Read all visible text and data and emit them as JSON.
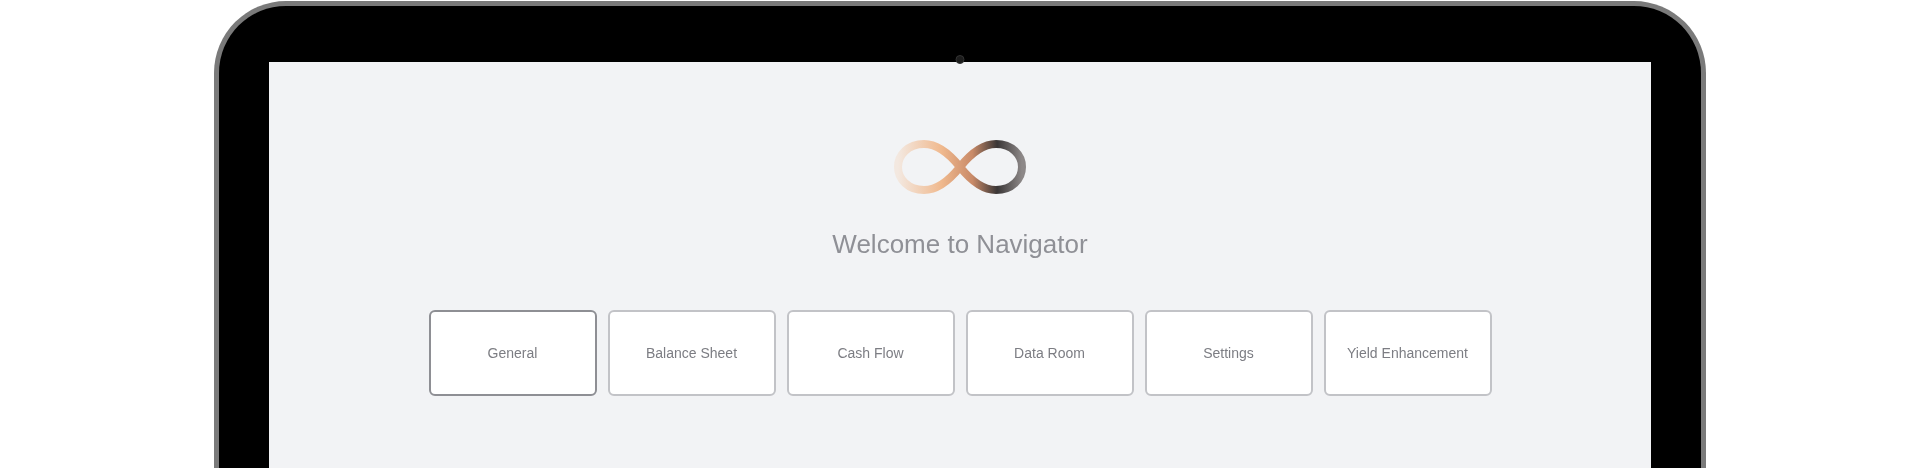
{
  "title": "Welcome to Navigator",
  "buttons": [
    {
      "label": "General",
      "selected": true
    },
    {
      "label": "Balance Sheet",
      "selected": false
    },
    {
      "label": "Cash Flow",
      "selected": false
    },
    {
      "label": "Data Room",
      "selected": false
    },
    {
      "label": "Settings",
      "selected": false
    },
    {
      "label": "Yield Enhancement",
      "selected": false
    }
  ]
}
